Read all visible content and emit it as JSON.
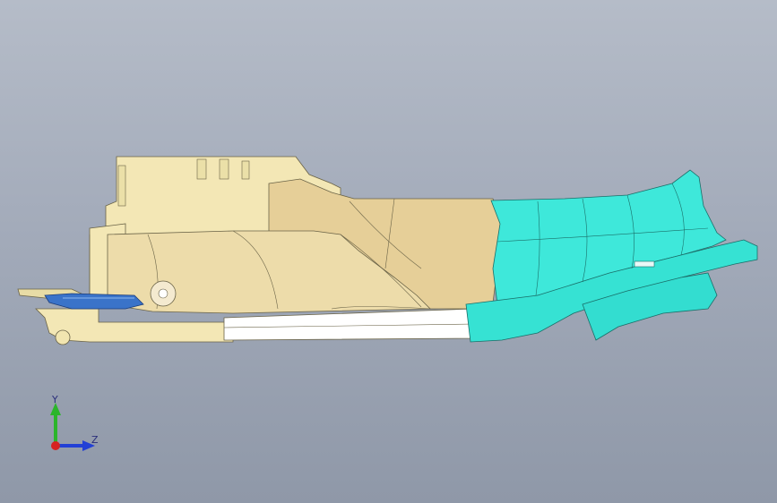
{
  "viewport": {
    "background_top": "#b5bcc8",
    "background_bottom": "#8f98a8"
  },
  "model": {
    "parts": [
      {
        "name": "housing-part",
        "color": "#f2e6b3"
      },
      {
        "name": "shell-part",
        "color": "#e0c58f"
      },
      {
        "name": "cover-part",
        "color": "#38e6d8"
      },
      {
        "name": "blue-insert-part",
        "color": "#3a73c9"
      }
    ]
  },
  "triad": {
    "y_label": "Y",
    "z_label": "Z",
    "y_color": "#2bb52b",
    "z_color": "#2240d6",
    "x_color": "#d62222",
    "icons": [
      "y-axis-arrow-icon",
      "z-axis-arrow-icon",
      "x-axis-dot-icon"
    ]
  }
}
